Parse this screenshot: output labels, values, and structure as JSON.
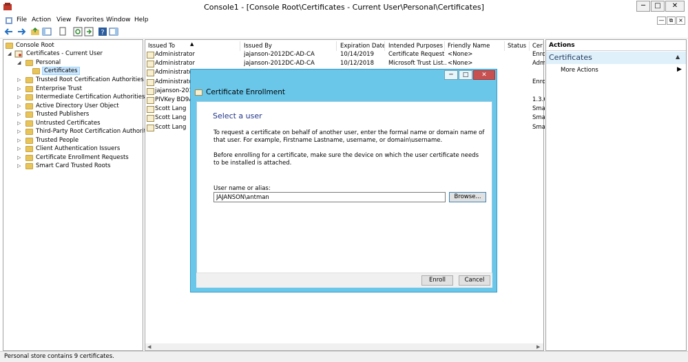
{
  "window": {
    "title": "Console1 - [Console Root\\Certificates - Current User\\Personal\\Certificates]"
  },
  "menu": [
    "File",
    "Action",
    "View",
    "Favorites",
    "Window",
    "Help"
  ],
  "tree": {
    "root": "Console Root",
    "certs_current_user": "Certificates - Current User",
    "personal": "Personal",
    "certificates": "Certificates",
    "children": [
      "Trusted Root Certification Authorities",
      "Enterprise Trust",
      "Intermediate Certification Authorities",
      "Active Directory User Object",
      "Trusted Publishers",
      "Untrusted Certificates",
      "Third-Party Root Certification Authorities",
      "Trusted People",
      "Client Authentication Issuers",
      "Certificate Enrollment Requests",
      "Smart Card Trusted Roots"
    ]
  },
  "list": {
    "columns": [
      "Issued To",
      "Issued By",
      "Expiration Date",
      "Intended Purposes",
      "Friendly Name",
      "Status",
      "Certi"
    ],
    "rows": [
      [
        "Administrator",
        "jajanson-2012DC-AD-CA",
        "10/14/2019",
        "Certificate Request ...",
        "<None>",
        "",
        "Enro"
      ],
      [
        "Administrator",
        "jajanson-2012DC-AD-CA",
        "10/12/2018",
        "Microsoft Trust List...",
        "<None>",
        "",
        "Adm"
      ],
      [
        "Administrator",
        "",
        "",
        "",
        "",
        "",
        ""
      ],
      [
        "Administrator",
        "",
        "",
        "",
        "",
        "",
        "Enro"
      ],
      [
        "jajanson-2012",
        "",
        "",
        "",
        "",
        "",
        ""
      ],
      [
        "PIVKey BD9AS",
        "",
        "",
        "",
        "",
        "",
        "1.3.6"
      ],
      [
        "Scott Lang",
        "",
        "",
        "",
        "",
        "",
        "Sma"
      ],
      [
        "Scott Lang",
        "",
        "",
        "",
        "",
        "",
        "Sma"
      ],
      [
        "Scott Lang",
        "",
        "",
        "",
        "",
        "",
        "Sma"
      ]
    ]
  },
  "actions": {
    "title": "Actions",
    "section": "Certificates",
    "more": "More Actions"
  },
  "status": "Personal store contains 9 certificates.",
  "dialog": {
    "title": "Certificate Enrollment",
    "heading": "Select a user",
    "para1": "To request a certificate on behalf of another user, enter the formal name or domain name of that user. For example, Firstname Lastname, username, or domain\\username.",
    "para2": "Before enrolling for a certificate, make sure the device on which the user certificate needs to be installed is attached.",
    "field_label": "User name or alias:",
    "field_value": "JAJANSON\\antman",
    "browse": "Browse...",
    "enroll": "Enroll",
    "cancel": "Cancel"
  }
}
